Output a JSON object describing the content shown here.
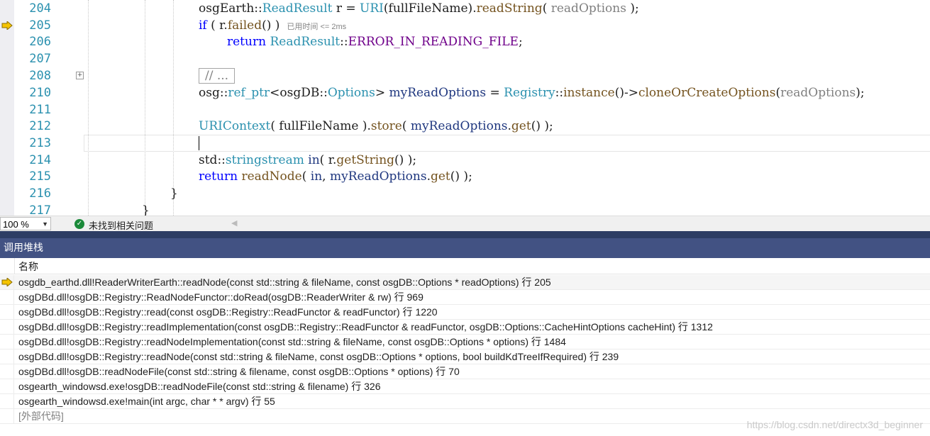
{
  "editor": {
    "lines": [
      {
        "num": "204",
        "parts": [
          {
            "t": "osgEarth",
            "c": ""
          },
          {
            "t": "::",
            "c": ""
          },
          {
            "t": "ReadResult",
            "c": "ty"
          },
          {
            "t": " r = ",
            "c": ""
          },
          {
            "t": "URI",
            "c": "ty"
          },
          {
            "t": "(fullFileName).",
            "c": ""
          },
          {
            "t": "readString",
            "c": "fn"
          },
          {
            "t": "( ",
            "c": ""
          },
          {
            "t": "readOptions",
            "c": "pa"
          },
          {
            "t": " );",
            "c": ""
          }
        ]
      },
      {
        "num": "205",
        "parts": [
          {
            "t": "if",
            "c": "kw"
          },
          {
            "t": " ( r.",
            "c": ""
          },
          {
            "t": "failed",
            "c": "fn"
          },
          {
            "t": "() )",
            "c": ""
          }
        ],
        "elapsed": "已用时间 <= 2ms"
      },
      {
        "num": "206",
        "parts": [
          {
            "t": "return",
            "c": "kw"
          },
          {
            "t": " ",
            "c": ""
          },
          {
            "t": "ReadResult",
            "c": "ty"
          },
          {
            "t": "::",
            "c": ""
          },
          {
            "t": "ERROR_IN_READING_FILE",
            "c": "mc"
          },
          {
            "t": ";",
            "c": ""
          }
        ]
      },
      {
        "num": "207",
        "parts": []
      },
      {
        "num": "208",
        "collapsed": "// ..."
      },
      {
        "num": "210",
        "parts": [
          {
            "t": "osg",
            "c": ""
          },
          {
            "t": "::",
            "c": ""
          },
          {
            "t": "ref_ptr",
            "c": "ty"
          },
          {
            "t": "<osgDB::",
            "c": ""
          },
          {
            "t": "Options",
            "c": "ty"
          },
          {
            "t": "> ",
            "c": ""
          },
          {
            "t": "myReadOptions",
            "c": "nm"
          },
          {
            "t": " = ",
            "c": ""
          },
          {
            "t": "Registry",
            "c": "ty"
          },
          {
            "t": "::",
            "c": ""
          },
          {
            "t": "instance",
            "c": "fn"
          },
          {
            "t": "()->",
            "c": ""
          },
          {
            "t": "cloneOrCreateOptions",
            "c": "fn"
          },
          {
            "t": "(",
            "c": ""
          },
          {
            "t": "readOptions",
            "c": "pa"
          },
          {
            "t": ");",
            "c": ""
          }
        ]
      },
      {
        "num": "211",
        "parts": []
      },
      {
        "num": "212",
        "parts": [
          {
            "t": "URIContext",
            "c": "ty"
          },
          {
            "t": "( fullFileName ).",
            "c": ""
          },
          {
            "t": "store",
            "c": "fn"
          },
          {
            "t": "( ",
            "c": ""
          },
          {
            "t": "myReadOptions",
            "c": "nm"
          },
          {
            "t": ".",
            "c": ""
          },
          {
            "t": "get",
            "c": "fn"
          },
          {
            "t": "() );",
            "c": ""
          }
        ]
      },
      {
        "num": "213",
        "parts": []
      },
      {
        "num": "214",
        "parts": [
          {
            "t": "std",
            "c": ""
          },
          {
            "t": "::",
            "c": ""
          },
          {
            "t": "stringstream",
            "c": "ty"
          },
          {
            "t": " ",
            "c": ""
          },
          {
            "t": "in",
            "c": "nm"
          },
          {
            "t": "( r.",
            "c": ""
          },
          {
            "t": "getString",
            "c": "fn"
          },
          {
            "t": "() );",
            "c": ""
          }
        ]
      },
      {
        "num": "215",
        "parts": [
          {
            "t": "return",
            "c": "kw"
          },
          {
            "t": " ",
            "c": ""
          },
          {
            "t": "readNode",
            "c": "fn"
          },
          {
            "t": "( ",
            "c": ""
          },
          {
            "t": "in",
            "c": "nm"
          },
          {
            "t": ", ",
            "c": ""
          },
          {
            "t": "myReadOptions",
            "c": "nm"
          },
          {
            "t": ".",
            "c": ""
          },
          {
            "t": "get",
            "c": "fn"
          },
          {
            "t": "() );",
            "c": ""
          }
        ]
      },
      {
        "num": "216",
        "parts": [
          {
            "t": "}",
            "c": ""
          }
        ]
      },
      {
        "num": "217",
        "parts": [
          {
            "t": "}",
            "c": ""
          }
        ]
      }
    ]
  },
  "status": {
    "zoom": "100 %",
    "message": "未找到相关问题"
  },
  "callstack": {
    "title": "调用堆栈",
    "column_name": "名称",
    "rows": [
      {
        "text": "osgdb_earthd.dll!ReaderWriterEarth::readNode(const std::string & fileName, const osgDB::Options * readOptions) 行 205",
        "current": true
      },
      {
        "text": "osgDBd.dll!osgDB::Registry::ReadNodeFunctor::doRead(osgDB::ReaderWriter & rw) 行 969"
      },
      {
        "text": "osgDBd.dll!osgDB::Registry::read(const osgDB::Registry::ReadFunctor & readFunctor) 行 1220"
      },
      {
        "text": "osgDBd.dll!osgDB::Registry::readImplementation(const osgDB::Registry::ReadFunctor & readFunctor, osgDB::Options::CacheHintOptions cacheHint) 行 1312"
      },
      {
        "text": "osgDBd.dll!osgDB::Registry::readNodeImplementation(const std::string & fileName, const osgDB::Options * options) 行 1484"
      },
      {
        "text": "osgDBd.dll!osgDB::Registry::readNode(const std::string & fileName, const osgDB::Options * options, bool buildKdTreeIfRequired) 行 239"
      },
      {
        "text": "osgDBd.dll!osgDB::readNodeFile(const std::string & filename, const osgDB::Options * options) 行 70"
      },
      {
        "text": "osgearth_windowsd.exe!osgDB::readNodeFile(const std::string & filename) 行 326"
      },
      {
        "text": "osgearth_windowsd.exe!main(int argc, char * * argv) 行 55"
      },
      {
        "text": "[外部代码]",
        "external": true
      }
    ]
  },
  "watermark": "https://blog.csdn.net/directx3d_beginner",
  "colors": {
    "panel_title_bg": "#425283",
    "current_arrow": "#f5c400",
    "line_number": "#2b91af"
  }
}
